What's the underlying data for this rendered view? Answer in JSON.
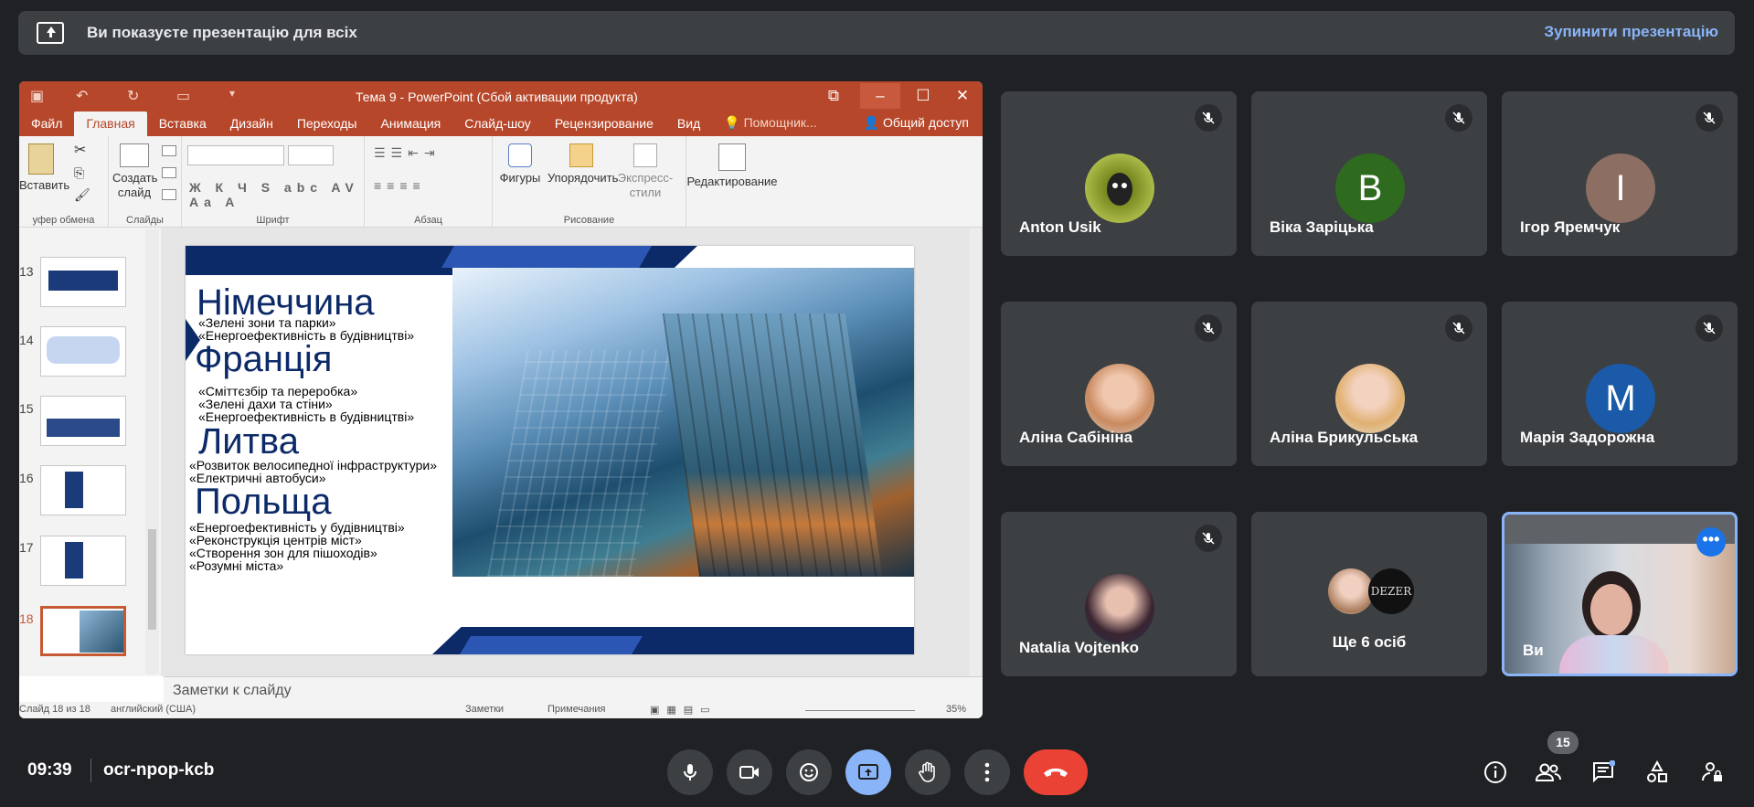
{
  "banner": {
    "text": "Ви показуєте презентацію для всіх",
    "stop": "Зупинити презентацію"
  },
  "ppt": {
    "title": "Тема 9 - PowerPoint (Сбой активации продукта)",
    "tabs": [
      "Файл",
      "Главная",
      "Вставка",
      "Дизайн",
      "Переходы",
      "Анимация",
      "Слайд-шоу",
      "Рецензирование",
      "Вид",
      "Помощник..."
    ],
    "active_tab": "Главная",
    "share": "Общий доступ",
    "ribbon": {
      "paste": "Вставить",
      "new_slide_1": "Создать",
      "new_slide_2": "слайд",
      "shapes": "Фигуры",
      "arrange": "Упорядочить",
      "styles_1": "Экспресс-",
      "styles_2": "стили",
      "editing": "Редактирование",
      "group_clipboard": "уфер обмена",
      "group_slides": "Слайды",
      "group_font": "Шрифт",
      "group_paragraph": "Абзац",
      "group_drawing": "Рисование",
      "font_buttons": "Ж К Ч S abc AV Aa A"
    },
    "thumb_numbers": [
      "13",
      "14",
      "15",
      "16",
      "17",
      "18"
    ],
    "slide": {
      "sections": [
        {
          "country": "Німеччина",
          "items": [
            "«Зелені зони та парки»",
            "«Енергоефективність в будівництві»"
          ]
        },
        {
          "country": "Франція",
          "items": [
            "«Сміттєзбір та переробка»",
            "«Зелені дахи та стіни»",
            "«Енергоефективність в будівництві»"
          ]
        },
        {
          "country": "Литва",
          "items": [
            "«Розвиток велосипедної інфраструктури»",
            "«Електричні автобуси»"
          ]
        },
        {
          "country": "Польща",
          "items": [
            "«Енергоефективність у будівництві»",
            "«Реконструкція центрів міст»",
            "«Створення зон для пішоходів»",
            "«Розумні міста»"
          ]
        }
      ]
    },
    "notes_placeholder": "Заметки к слайду",
    "status": {
      "slide": "Слайд 18 из 18",
      "lang": "английский (США)",
      "notes": "Заметки",
      "comments": "Примечания",
      "zoom": "35%"
    }
  },
  "participants": [
    {
      "name": "Anton Usik",
      "initial": "",
      "color": "#9aa53a"
    },
    {
      "name": "Віка Заріцька",
      "initial": "В",
      "color": "#2e6b1e"
    },
    {
      "name": "Ігор Яремчук",
      "initial": "І",
      "color": "#8d6e63"
    },
    {
      "name": "Аліна Сабініна",
      "initial": "",
      "color": "#c9a58b"
    },
    {
      "name": "Аліна Брикульська",
      "initial": "",
      "color": "#d9b8a2"
    },
    {
      "name": "Марія Задорожна",
      "initial": "М",
      "color": "#1a5aa8"
    },
    {
      "name": "Natalia Vojtenko",
      "initial": "",
      "color": "#4a3a4a"
    }
  ],
  "others": {
    "text": "Ще 6 осіб",
    "logo": "DEZER"
  },
  "self": {
    "name": "Ви"
  },
  "meeting": {
    "time": "09:39",
    "code": "ocr-npop-kcb",
    "participant_count": "15"
  },
  "colors": {
    "accent": "#8ab4f8",
    "end_call": "#ea4335",
    "ppt_orange": "#b7472a"
  }
}
